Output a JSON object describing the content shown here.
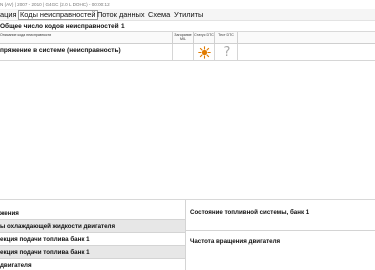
{
  "window": {
    "title": "N (AV) | 2007 - 2010 | G4GC (2.0 L DOHC) - 00:00:12"
  },
  "menu": {
    "items": [
      {
        "label": "ация"
      },
      {
        "label": "Коды неисправностей"
      },
      {
        "label": "Поток данных"
      },
      {
        "label": "Схема"
      },
      {
        "label": "Утилиты"
      }
    ]
  },
  "dtc_summary": {
    "label": "Общее число кодов неисправностей",
    "count": "1"
  },
  "dtc_table": {
    "columns": {
      "description": "Описание кода неисправности",
      "mil": "Загорание MIL",
      "status": "Статус DTC",
      "test": "Тест DTC"
    },
    "rows": [
      {
        "description": "пряжение в системе (неисправность)",
        "mil": "",
        "status_icon": "sun-icon",
        "test_icon": "question-icon",
        "test_symbol": "?",
        "status_color": "#e07b00"
      }
    ]
  },
  "freeze_frame": {
    "left": [
      {
        "label": "жения"
      },
      {
        "label": "ы охлаждающей жидкости двигателя"
      },
      {
        "label": "екция подачи топлива банк 1"
      },
      {
        "label": "екция подачи топлива банк 1"
      },
      {
        "label": "двигателя"
      }
    ],
    "right": [
      {
        "label": "Состояние топливной системы, банк 1"
      },
      {
        "label": "Частота вращения двигателя"
      }
    ]
  }
}
